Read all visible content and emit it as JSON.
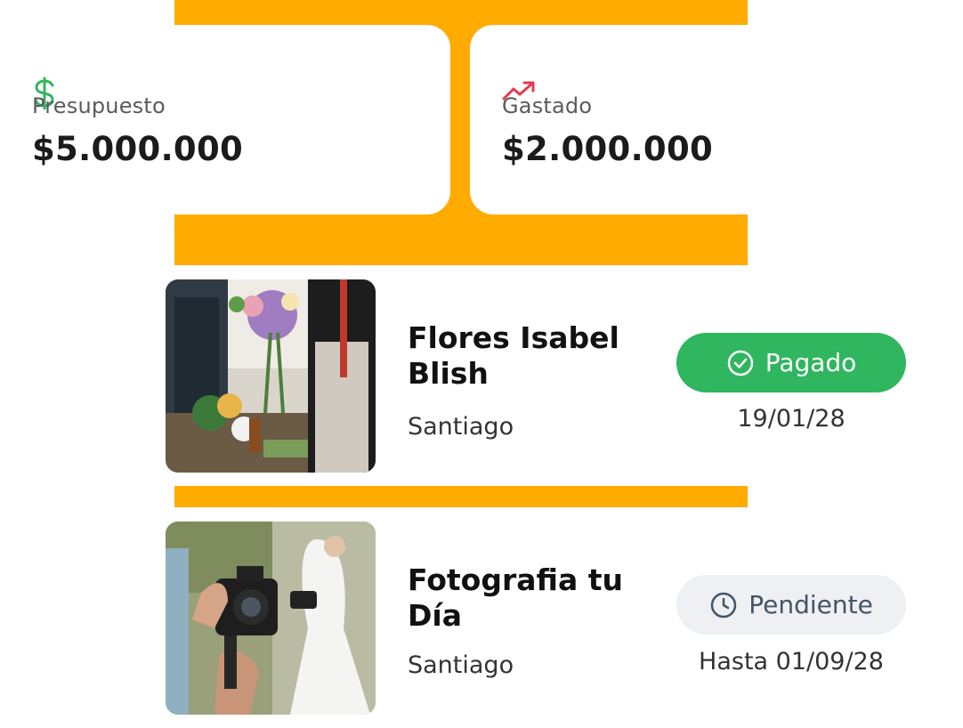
{
  "summary": {
    "budget": {
      "label": "Presupuesto",
      "value": "$5.000.000",
      "icon": "dollar-icon",
      "icon_color": "#2fb65f"
    },
    "spent": {
      "label": "Gastado",
      "value": "$2.000.000",
      "icon": "trending-up-icon",
      "icon_color": "#e8394f"
    }
  },
  "vendors": [
    {
      "name": "Flores Isabel Blish",
      "city": "Santiago",
      "image": "florist-photo",
      "status": {
        "label": "Pagado",
        "icon": "check-circle-icon",
        "color": "#2fb65f"
      },
      "date": "19/01/28"
    },
    {
      "name": "Fotografia tu Día",
      "city": "Santiago",
      "image": "wedding-photographer-photo",
      "status": {
        "label": "Pendiente",
        "icon": "clock-icon",
        "color": "#445566"
      },
      "date": "Hasta 01/09/28"
    }
  ],
  "colors": {
    "accent": "#ffab00",
    "paid": "#2fb65f",
    "pending_bg": "#eef0f3"
  }
}
